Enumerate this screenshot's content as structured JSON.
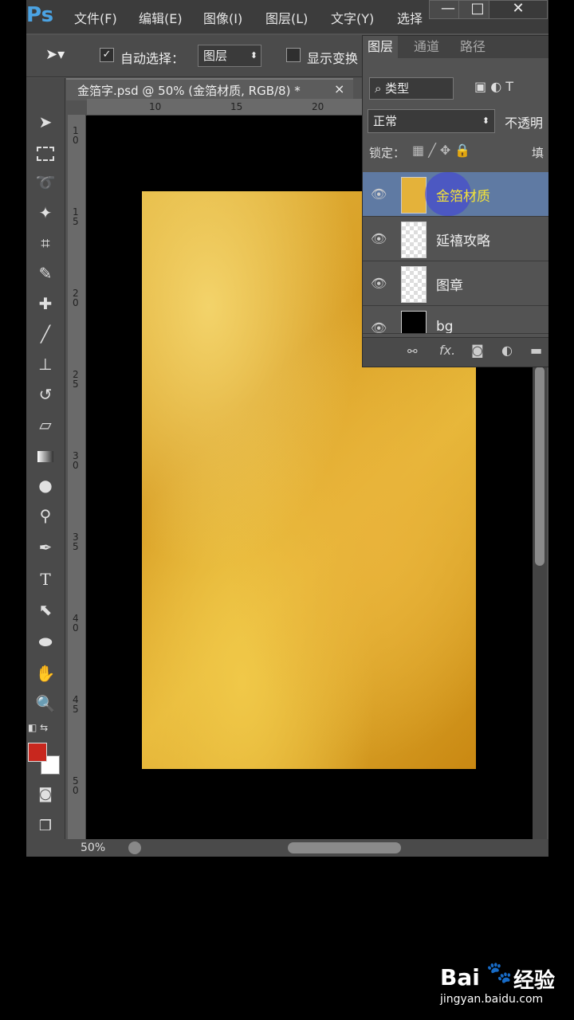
{
  "app": {
    "logo": "Ps",
    "menus": [
      "文件(F)",
      "编辑(E)",
      "图像(I)",
      "图层(L)",
      "文字(Y)",
      "选择"
    ],
    "window_controls": {
      "minimize": "—",
      "maximize": "□",
      "close": "✕"
    }
  },
  "options": {
    "auto_select_label": "自动选择：",
    "auto_select_value": "图层",
    "show_transform_label": "显示变换"
  },
  "document": {
    "tab_title": "金箔字.psd @ 50% (金箔材质, RGB/8) *",
    "tab_close": "×",
    "zoom": "50%",
    "ruler_top": [
      "10",
      "15",
      "20"
    ],
    "ruler_left": [
      [
        "1",
        "0"
      ],
      [
        "1",
        "5"
      ],
      [
        "2",
        "0"
      ],
      [
        "2",
        "5"
      ],
      [
        "3",
        "0"
      ],
      [
        "3",
        "5"
      ],
      [
        "4",
        "0"
      ],
      [
        "4",
        "5"
      ],
      [
        "5",
        "0"
      ]
    ],
    "canvas_colors": {
      "background": "#000000",
      "gold_base": "#e0a92c"
    }
  },
  "toolbar": {
    "icons": [
      "move-icon",
      "marquee-icon",
      "lasso-icon",
      "magic-wand-icon",
      "crop-icon",
      "eyedropper-icon",
      "healing-icon",
      "brush-icon",
      "stamp-icon",
      "history-brush-icon",
      "eraser-icon",
      "gradient-icon",
      "blur-icon",
      "dodge-icon",
      "pen-icon",
      "type-icon",
      "path-select-icon",
      "shape-icon",
      "hand-icon",
      "zoom-icon"
    ],
    "type_glyph": "T",
    "foreground_color": "#c8271e",
    "background_color": "#ffffff"
  },
  "layers_panel": {
    "tabs": [
      "图层",
      "通道",
      "路径"
    ],
    "active_tab": "图层",
    "filter_label": "类型",
    "blend_mode": "正常",
    "opacity_label": "不透明",
    "lock_label": "锁定：",
    "fill_label": "填",
    "layers": [
      {
        "name": "金箔材质",
        "selected": true
      },
      {
        "name": "延禧攻略",
        "selected": false
      },
      {
        "name": "图章",
        "selected": false
      },
      {
        "name": "bg",
        "selected": false
      }
    ],
    "footer_fx": "fx."
  },
  "watermark": {
    "brand": "Bai",
    "brand2": "经验",
    "url": "jingyan.baidu.com"
  }
}
